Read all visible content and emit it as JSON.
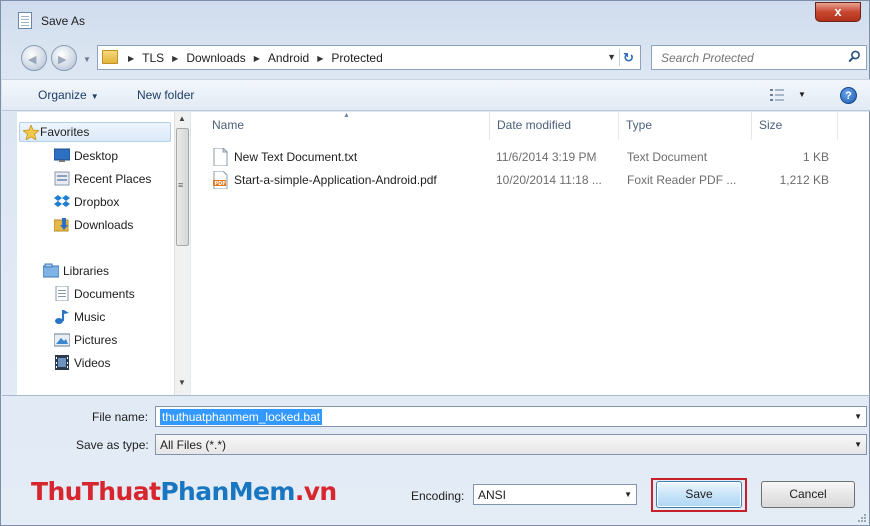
{
  "window": {
    "title": "Save As",
    "close_label": "x"
  },
  "address": {
    "crumbs": [
      "TLS",
      "Downloads",
      "Android",
      "Protected"
    ],
    "search_placeholder": "Search Protected"
  },
  "toolbar": {
    "organize_label": "Organize",
    "new_folder_label": "New folder"
  },
  "nav": {
    "favorites_label": "Favorites",
    "favorites": [
      "Desktop",
      "Recent Places",
      "Dropbox",
      "Downloads"
    ],
    "libraries_label": "Libraries",
    "libraries": [
      "Documents",
      "Music",
      "Pictures",
      "Videos"
    ]
  },
  "files": {
    "columns": [
      "Name",
      "Date modified",
      "Type",
      "Size"
    ],
    "rows": [
      {
        "name": "New Text Document.txt",
        "date": "11/6/2014 3:19 PM",
        "type": "Text Document",
        "size": "1 KB",
        "icon": "text-file-icon"
      },
      {
        "name": "Start-a-simple-Application-Android.pdf",
        "date": "10/20/2014 11:18 ...",
        "type": "Foxit Reader PDF ...",
        "size": "1,212 KB",
        "icon": "pdf-file-icon"
      }
    ]
  },
  "form": {
    "file_name_label": "File name:",
    "file_name_value": "thuthuatphanmem_locked.bat",
    "save_type_label": "Save as type:",
    "save_type_value": "All Files  (*.*)",
    "encoding_label": "Encoding:",
    "encoding_value": "ANSI"
  },
  "buttons": {
    "save": "Save",
    "cancel": "Cancel"
  },
  "watermark": {
    "part1": "ThuThuat",
    "part2": "PhanMem",
    "part3": ".vn"
  },
  "colors": {
    "accent_red": "#c8202a",
    "selection_blue": "#3399ff",
    "brand_blue": "#1976c0"
  }
}
